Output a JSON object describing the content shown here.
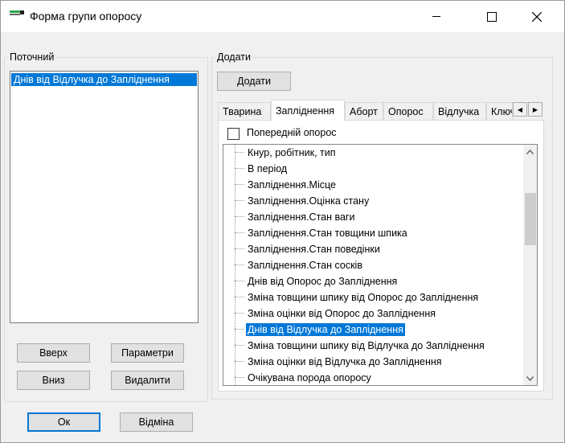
{
  "window": {
    "title": "Форма групи опоросу"
  },
  "current": {
    "group_label": "Поточний",
    "items": [
      "Днів від Відлучка  до Запліднення"
    ]
  },
  "buttons": {
    "up": "Вверх",
    "params": "Параметри",
    "down": "Вниз",
    "delete": "Видалити",
    "ok": "Ок",
    "cancel": "Відміна"
  },
  "add": {
    "group_label": "Додати",
    "button": "Додати"
  },
  "tabs": [
    "Тварина",
    "Запліднення",
    "Аборт",
    "Опорос",
    "Відлучка",
    "Ключ"
  ],
  "active_tab": "Запліднення",
  "panel": {
    "checkbox_label": "Попередній опорос",
    "checkbox_checked": false
  },
  "tree_items": [
    "Кнур, робітник, тип",
    "В період",
    "Запліднення.Місце",
    "Запліднення.Оцінка стану",
    "Запліднення.Стан ваги",
    "Запліднення.Стан товщини шпика",
    "Запліднення.Стан поведінки",
    "Запліднення.Стан сосків",
    "Днів від Опорос  до Запліднення",
    "Зміна товщини шпику від Опорос до Запліднення",
    "Зміна оцінки від Опорос до Запліднення",
    "Днів від Відлучка  до Запліднення",
    "Зміна товщини шпику від Відлучка до Запліднення",
    "Зміна оцінки від Відлучка до Запліднення",
    "Очікувана порода опоросу"
  ],
  "selected_tree_item": "Днів від Відлучка  до Запліднення",
  "colors": {
    "selection": "#0078d7",
    "window_bg": "#f0f0f0",
    "default_button_border": "#0078d7"
  }
}
